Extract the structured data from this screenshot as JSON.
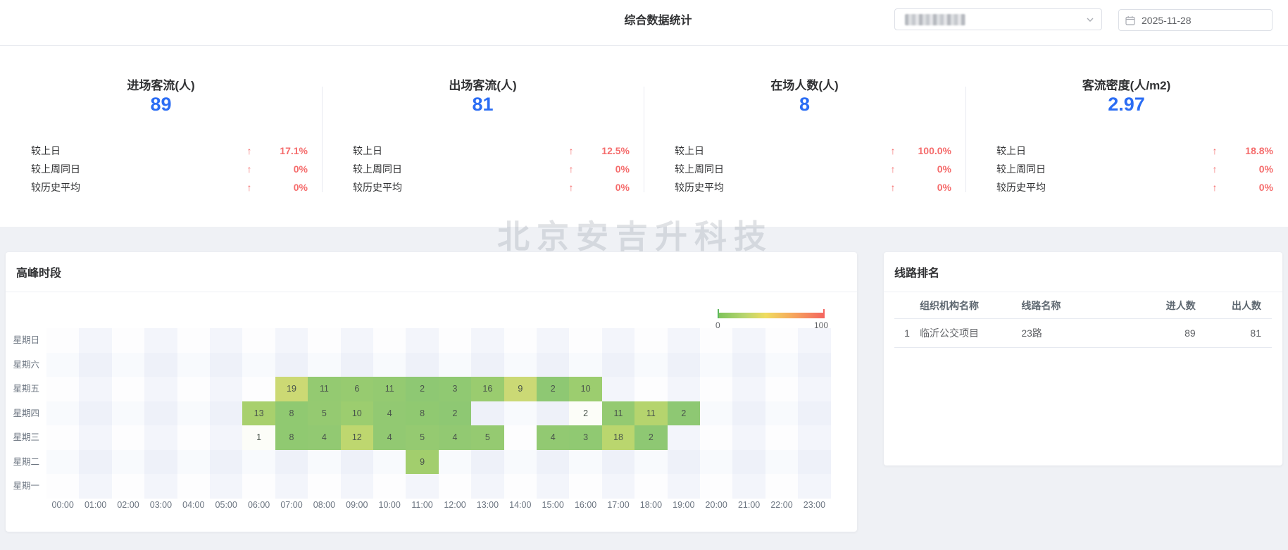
{
  "header": {
    "title": "综合数据统计",
    "org_select": {
      "value_redacted": "",
      "icon": "chevron-down"
    },
    "date_picker": {
      "value": "2025-11-28",
      "icon": "calendar"
    }
  },
  "kpis": [
    {
      "title": "进场客流(人)",
      "value": "89",
      "rows": [
        {
          "label": "较上日",
          "arrow": "↑",
          "pct": "17.1%"
        },
        {
          "label": "较上周同日",
          "arrow": "↑",
          "pct": "0%"
        },
        {
          "label": "较历史平均",
          "arrow": "↑",
          "pct": "0%"
        }
      ]
    },
    {
      "title": "出场客流(人)",
      "value": "81",
      "rows": [
        {
          "label": "较上日",
          "arrow": "↑",
          "pct": "12.5%"
        },
        {
          "label": "较上周同日",
          "arrow": "↑",
          "pct": "0%"
        },
        {
          "label": "较历史平均",
          "arrow": "↑",
          "pct": "0%"
        }
      ]
    },
    {
      "title": "在场人数(人)",
      "value": "8",
      "rows": [
        {
          "label": "较上日",
          "arrow": "↑",
          "pct": "100.0%"
        },
        {
          "label": "较上周同日",
          "arrow": "↑",
          "pct": "0%"
        },
        {
          "label": "较历史平均",
          "arrow": "↑",
          "pct": "0%"
        }
      ]
    },
    {
      "title": "客流密度(人/m2)",
      "value": "2.97",
      "rows": [
        {
          "label": "较上日",
          "arrow": "↑",
          "pct": "18.8%"
        },
        {
          "label": "较上周同日",
          "arrow": "↑",
          "pct": "0%"
        },
        {
          "label": "较历史平均",
          "arrow": "↑",
          "pct": "0%"
        }
      ]
    }
  ],
  "watermark": "北京安吉升科技",
  "chart_data": {
    "type": "heatmap",
    "panel_title": "高峰时段",
    "legend": {
      "min": "0",
      "max": "100",
      "colors": [
        "#7dc35a",
        "#f0dc5f",
        "#f4655f"
      ],
      "position": "top-right"
    },
    "days": [
      "星期日",
      "星期六",
      "星期五",
      "星期四",
      "星期三",
      "星期二",
      "星期一"
    ],
    "hours": [
      "00:00",
      "01:00",
      "02:00",
      "03:00",
      "04:00",
      "05:00",
      "06:00",
      "07:00",
      "08:00",
      "09:00",
      "10:00",
      "11:00",
      "12:00",
      "13:00",
      "14:00",
      "15:00",
      "16:00",
      "17:00",
      "18:00",
      "19:00",
      "20:00",
      "21:00",
      "22:00",
      "23:00"
    ],
    "cells": [
      {
        "day": 2,
        "hour": 7,
        "value": 19,
        "color": "#ccd974"
      },
      {
        "day": 2,
        "hour": 8,
        "value": 11,
        "color": "#94ca71"
      },
      {
        "day": 2,
        "hour": 9,
        "value": 6,
        "color": "#97cb70"
      },
      {
        "day": 2,
        "hour": 10,
        "value": 11,
        "color": "#94ca71"
      },
      {
        "day": 2,
        "hour": 11,
        "value": 2,
        "color": "#8ec873"
      },
      {
        "day": 2,
        "hour": 12,
        "value": 3,
        "color": "#90c972"
      },
      {
        "day": 2,
        "hour": 13,
        "value": 16,
        "color": "#9acc6f"
      },
      {
        "day": 2,
        "hour": 14,
        "value": 9,
        "color": "#cbd975"
      },
      {
        "day": 2,
        "hour": 15,
        "value": 2,
        "color": "#8ec873"
      },
      {
        "day": 2,
        "hour": 16,
        "value": 10,
        "color": "#9ccd6f"
      },
      {
        "day": 3,
        "hour": 6,
        "value": 13,
        "color": "#a8d06d"
      },
      {
        "day": 3,
        "hour": 7,
        "value": 8,
        "color": "#90c971"
      },
      {
        "day": 3,
        "hour": 8,
        "value": 5,
        "color": "#95ca71"
      },
      {
        "day": 3,
        "hour": 9,
        "value": 10,
        "color": "#9ccd6f"
      },
      {
        "day": 3,
        "hour": 10,
        "value": 4,
        "color": "#92c972"
      },
      {
        "day": 3,
        "hour": 11,
        "value": 8,
        "color": "#90c971"
      },
      {
        "day": 3,
        "hour": 12,
        "value": 2,
        "color": "#8ec873"
      },
      {
        "day": 3,
        "hour": 16,
        "value": 2,
        "color": "#fcfdf8"
      },
      {
        "day": 3,
        "hour": 17,
        "value": 11,
        "color": "#94ca71"
      },
      {
        "day": 3,
        "hour": 18,
        "value": 11,
        "color": "#b5d46e"
      },
      {
        "day": 3,
        "hour": 19,
        "value": 2,
        "color": "#8ec873"
      },
      {
        "day": 4,
        "hour": 6,
        "value": 1,
        "color": "#fcfdf8"
      },
      {
        "day": 4,
        "hour": 7,
        "value": 8,
        "color": "#90c971"
      },
      {
        "day": 4,
        "hour": 8,
        "value": 4,
        "color": "#92c972"
      },
      {
        "day": 4,
        "hour": 9,
        "value": 12,
        "color": "#bed76f"
      },
      {
        "day": 4,
        "hour": 10,
        "value": 4,
        "color": "#92c972"
      },
      {
        "day": 4,
        "hour": 11,
        "value": 5,
        "color": "#95ca71"
      },
      {
        "day": 4,
        "hour": 12,
        "value": 4,
        "color": "#92c972"
      },
      {
        "day": 4,
        "hour": 13,
        "value": 5,
        "color": "#95ca71"
      },
      {
        "day": 4,
        "hour": 15,
        "value": 4,
        "color": "#92c972"
      },
      {
        "day": 4,
        "hour": 16,
        "value": 3,
        "color": "#90c972"
      },
      {
        "day": 4,
        "hour": 17,
        "value": 18,
        "color": "#bad66e"
      },
      {
        "day": 4,
        "hour": 18,
        "value": 2,
        "color": "#8ec873"
      },
      {
        "day": 5,
        "hour": 11,
        "value": 9,
        "color": "#a2ce6d"
      }
    ]
  },
  "ranking": {
    "panel_title": "线路排名",
    "columns": {
      "org": "组织机构名称",
      "line": "线路名称",
      "in": "进人数",
      "out": "出人数"
    },
    "rows": [
      {
        "rank": "1",
        "org": "临沂公交项目",
        "line": "23路",
        "in": "89",
        "out": "81"
      }
    ]
  }
}
